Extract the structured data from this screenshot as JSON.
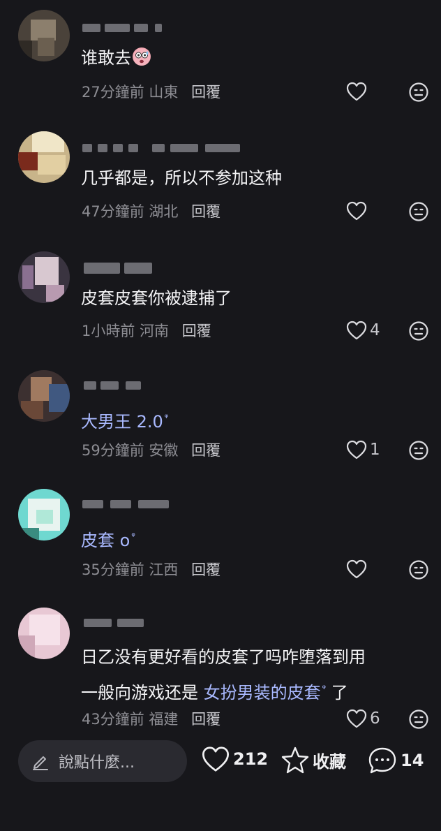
{
  "comments": [
    {
      "text": "谁敢去",
      "time": "27分鐘前",
      "location": "山東",
      "reply": "回覆",
      "likes": "",
      "emoji": "sweating-surprised-face"
    },
    {
      "text": "几乎都是，所以不参加这种",
      "time": "47分鐘前",
      "location": "湖北",
      "reply": "回覆",
      "likes": ""
    },
    {
      "text": "皮套皮套你被逮捕了",
      "time": "1小時前",
      "location": "河南",
      "reply": "回覆",
      "likes": "4"
    },
    {
      "text": "大男王 2.0",
      "time": "59分鐘前",
      "location": "安徽",
      "reply": "回覆",
      "likes": "1"
    },
    {
      "text": "皮套 o",
      "time": "35分鐘前",
      "location": "江西",
      "reply": "回覆",
      "likes": ""
    },
    {
      "line1": "日乙没有更好看的皮套了吗咋堕落到用",
      "line2_pre": "一般向游戏还是",
      "line2_link": "女扮男装的皮套",
      "line2_post": "了",
      "time": "43分鐘前",
      "location": "福建",
      "reply": "回覆",
      "likes": "6"
    }
  ],
  "search_suffix_icon": "search-icon",
  "bottom": {
    "input_placeholder": "說點什麼...",
    "likes_count": "212",
    "favorite_label": "收藏",
    "comments_count": "14"
  },
  "colors": {
    "background": "#17171b",
    "link": "#a9b9ff",
    "meta": "#8d8d93"
  }
}
